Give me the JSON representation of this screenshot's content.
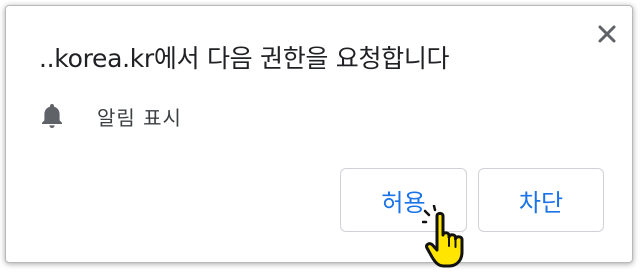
{
  "dialog": {
    "title": "..korea.kr에서 다음 권한을 요청합니다",
    "permission": {
      "icon": "bell-icon",
      "label": "알림 표시"
    },
    "buttons": {
      "allow_label": "허용",
      "block_label": "차단"
    },
    "close_icon": "close-icon"
  },
  "colors": {
    "button_text": "#1a73e8",
    "title_text": "#202124",
    "icon_gray": "#5f6368",
    "cursor_fill": "#ffe500"
  }
}
